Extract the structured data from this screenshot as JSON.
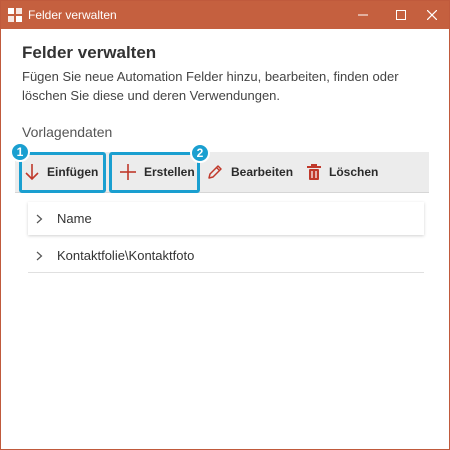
{
  "window": {
    "title": "Felder verwalten"
  },
  "header": {
    "title": "Felder verwalten",
    "description": "Fügen Sie neue Automation Felder hinzu, bearbeiten, finden oder löschen Sie diese und deren Verwendungen."
  },
  "section": {
    "label": "Vorlagendaten"
  },
  "toolbar": {
    "insert_label": "Einfügen",
    "create_label": "Erstellen",
    "edit_label": "Bearbeiten",
    "delete_label": "Löschen"
  },
  "callouts": [
    "1",
    "2"
  ],
  "tree": {
    "items": [
      {
        "label": "Name"
      },
      {
        "label": "Kontaktfolie\\Kontaktfoto"
      }
    ]
  },
  "colors": {
    "titlebar": "#c5603f",
    "accent_icon": "#c0392b",
    "highlight": "#1a9fd0"
  },
  "icons": [
    "app-icon",
    "minimize-icon",
    "maximize-icon",
    "close-icon",
    "arrow-down-icon",
    "plus-icon",
    "pencil-icon",
    "trash-icon",
    "chevron-right-icon"
  ]
}
